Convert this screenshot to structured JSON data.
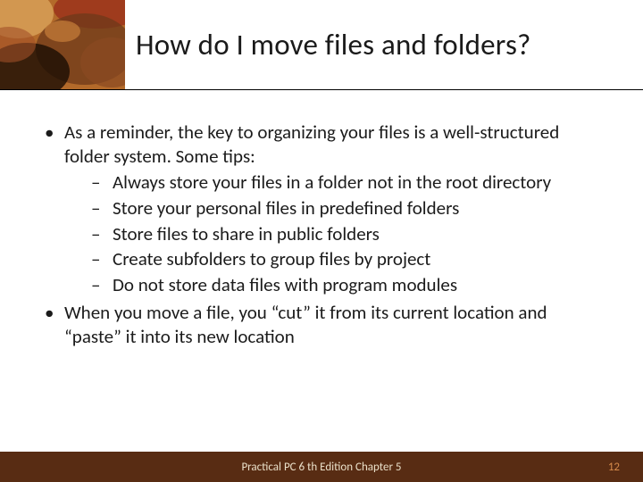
{
  "slide": {
    "title": "How do I move files and folders?",
    "bullets": [
      {
        "text": "As a reminder, the key to organizing your files is a well-structured folder system. Some tips:",
        "sub": [
          "Always store your files in a folder not in the root directory",
          "Store your personal files in predefined folders",
          "Store files to share in public folders",
          "Create subfolders to group files by project",
          "Do not store data files with program modules"
        ]
      },
      {
        "text": "When you move a file, you “cut” it from its current location and “paste” it into its new location",
        "sub": []
      }
    ],
    "footer": "Practical PC 6 th Edition Chapter 5",
    "page_number": "12"
  },
  "decor": {
    "corner_colors": {
      "base": "#b36a2a",
      "dark": "#6e3a19",
      "light": "#d9a35a",
      "red": "#9b321b",
      "black": "#1a0d04"
    }
  }
}
